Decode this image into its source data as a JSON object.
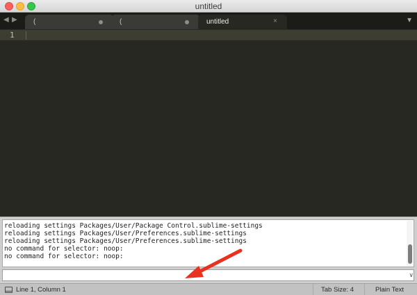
{
  "window": {
    "title": "untitled"
  },
  "tabs": [
    {
      "label": "(",
      "modified": true
    },
    {
      "label": "(",
      "modified": true
    },
    {
      "label": "untitled",
      "active": true,
      "close": "×"
    }
  ],
  "tab_nav": {
    "back": "◀",
    "forward": "▶",
    "overflow": "▼"
  },
  "editor": {
    "line_numbers": [
      "1"
    ]
  },
  "console": {
    "lines": [
      "reloading settings Packages/User/Package Control.sublime-settings",
      "reloading settings Packages/User/Preferences.sublime-settings",
      "reloading settings Packages/User/Preferences.sublime-settings",
      "no command for selector: noop:",
      "no command for selector: noop:"
    ],
    "input_value": "",
    "chevron": "∨"
  },
  "annotation": {
    "arrow_color": "#e8321f"
  },
  "statusbar": {
    "position": "Line 1, Column 1",
    "tab_size": "Tab Size: 4",
    "syntax": "Plain Text"
  },
  "colors": {
    "editor_bg": "#272822",
    "tabbar_bg": "#1b1c18",
    "console_bg": "#ffffff",
    "statusbar_bg": "#c2c2c2"
  }
}
